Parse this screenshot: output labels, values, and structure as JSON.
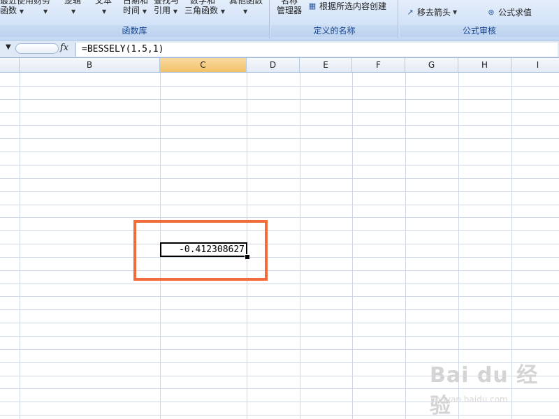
{
  "ribbon": {
    "function_library": {
      "label": "函数库",
      "buttons": [
        {
          "line1": "最近使用",
          "line2": "函数"
        },
        {
          "line1": "财务",
          "line2": ""
        },
        {
          "line1": "逻辑",
          "line2": ""
        },
        {
          "line1": "文本",
          "line2": ""
        },
        {
          "line1": "日期和",
          "line2": "时间"
        },
        {
          "line1": "查找与",
          "line2": "引用"
        },
        {
          "line1": "数学和",
          "line2": "三角函数"
        },
        {
          "line1": "其他函数",
          "line2": ""
        }
      ]
    },
    "defined_names": {
      "label": "定义的名称",
      "name_manager_line1": "名称",
      "name_manager_line2": "管理器",
      "create_from_selection": "根据所选内容创建"
    },
    "formula_auditing": {
      "label": "公式审核",
      "remove_arrows": "移去箭头",
      "evaluate_formula": "公式求值"
    }
  },
  "formula_bar": {
    "fx": "fx",
    "formula": "=BESSELY(1.5,1)"
  },
  "columns": [
    "B",
    "C",
    "D",
    "E",
    "F",
    "G",
    "H",
    "I"
  ],
  "selected_column": "C",
  "active_cell_value": "-0.412308627",
  "watermark": "Bai du 经验",
  "watermark_sub": "jingyan.baidu.com"
}
